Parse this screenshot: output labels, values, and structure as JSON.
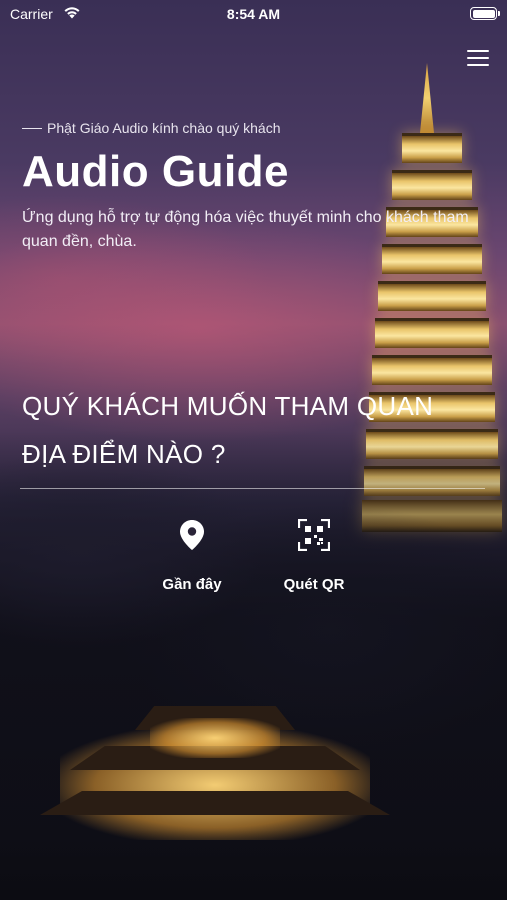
{
  "status_bar": {
    "carrier": "Carrier",
    "time": "8:54 AM",
    "wifi_icon": "wifi-icon",
    "battery_icon": "battery-icon"
  },
  "header": {
    "menu_icon": "hamburger-menu-icon",
    "greeting": "Phật Giáo Audio kính chào quý khách",
    "title": "Audio Guide",
    "subtitle": "Ứng dụng hỗ trợ tự động hóa việc thuyết minh cho khách tham quan đền, chùa."
  },
  "question": {
    "line1": "QUÝ KHÁCH MUỐN THAM QUAN",
    "line2": "ĐỊA ĐIỂM NÀO ?"
  },
  "actions": [
    {
      "label": "Gần đây",
      "icon": "location-pin-icon"
    },
    {
      "label": "Quét QR",
      "icon": "qr-scan-icon"
    }
  ],
  "colors": {
    "text": "#ffffff",
    "background_dark": "#15131f",
    "sunset_accent": "#8a5070",
    "pagoda_gold": "#e9c46a"
  }
}
